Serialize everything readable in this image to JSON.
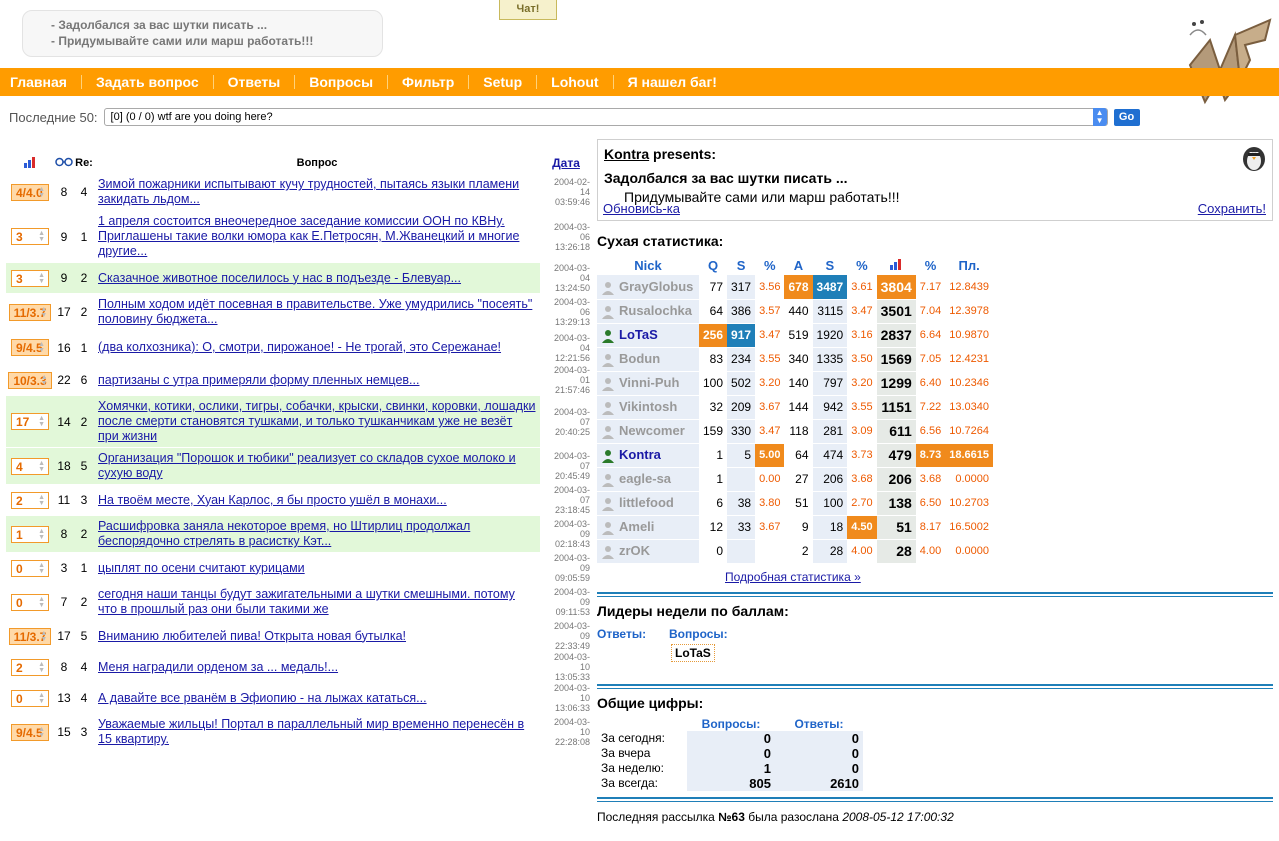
{
  "header": {
    "motd_line1": "- Задолбался за вас шутки писать ...",
    "motd_line2": "- Придумывайте сами или марш работать!!!",
    "chat_label": "Чат!"
  },
  "nav": [
    {
      "label": "Главная"
    },
    {
      "label": "Задать вопрос"
    },
    {
      "label": "Ответы"
    },
    {
      "label": "Вопросы"
    },
    {
      "label": "Фильтр"
    },
    {
      "label": "Setup"
    },
    {
      "label": "Lohout"
    },
    {
      "label": "Я нашел баг!"
    }
  ],
  "filter": {
    "label": "Последние 50:",
    "selected": "[0] (0 / 0) wtf are you doing here?",
    "go_label": "Go"
  },
  "questions_table": {
    "headers": {
      "re": "Re:",
      "question": "Вопрос",
      "date": "Дата"
    },
    "rows": [
      {
        "rate": "4/4.0",
        "views": "8",
        "re": "4",
        "text": "Зимой пожарники испытывают кучу трудностей, пытаясь языки пламени закидать льдом...",
        "date1": "2004-02-",
        "date2": "14",
        "time": "03:59:46",
        "highlight": false,
        "filled": true
      },
      {
        "rate": "3",
        "views": "9",
        "re": "1",
        "text": "1 апреля состоится внеочередное заседание комиссии ООН по КВНу. Приглашены такие волки юмора как Е.Петросян, М.Жванецкий и многие другие...",
        "date1": "2004-03-",
        "date2": "06",
        "time": "13:26:18",
        "highlight": false,
        "filled": false
      },
      {
        "rate": "3",
        "views": "9",
        "re": "2",
        "text": "Сказачное животное поселилось у нас в подъезде - Блевуар...",
        "date1": "2004-03-",
        "date2": "04",
        "time": "13:24:50",
        "highlight": true,
        "filled": false
      },
      {
        "rate": "11/3.7",
        "views": "17",
        "re": "2",
        "text": "Полным ходом идёт посевная в правительстве. Уже умудрились \"посеять\" половину бюджета...",
        "date1": "2004-03-",
        "date2": "06",
        "time": "13:29:13",
        "highlight": false,
        "filled": true
      },
      {
        "rate": "9/4.5",
        "views": "16",
        "re": "1",
        "text": "(два колхозника): О, смотри, пирожаное! - Не трогай, это Сережанае!",
        "date1": "2004-03-",
        "date2": "04",
        "time": "12:21:56",
        "highlight": false,
        "filled": true
      },
      {
        "rate": "10/3.3",
        "views": "22",
        "re": "6",
        "text": "партизаны с утра примеряли форму пленных немцев...",
        "date1": "2004-03-",
        "date2": "01",
        "time": "21:57:46",
        "highlight": false,
        "filled": true
      },
      {
        "rate": "17",
        "views": "14",
        "re": "2",
        "text": "Хомячки, котики, ослики, тигры, собачки, крыски, свинки, коровки, лошадки после смерти становятся тушками, и только тушканчикам уже не везёт при жизни",
        "date1": "2004-03-",
        "date2": "07",
        "time": "20:40:25",
        "highlight": true,
        "filled": false
      },
      {
        "rate": "4",
        "views": "18",
        "re": "5",
        "text": "Организация \"Порошок и тюбики\" реализует со складов сухое молоко и сухую воду",
        "date1": "2004-03-",
        "date2": "07",
        "time": "20:45:49",
        "highlight": true,
        "filled": false
      },
      {
        "rate": "2",
        "views": "11",
        "re": "3",
        "text": "На твоём месте, Хуан Карлос, я бы просто ушёл в монахи...",
        "date1": "2004-03-",
        "date2": "07",
        "time": "23:18:45",
        "highlight": false,
        "filled": false
      },
      {
        "rate": "1",
        "views": "8",
        "re": "2",
        "text": "Расшифровка заняла некоторое время, но Штирлиц продолжал беспорядочно стрелять в расистку Кэт...",
        "date1": "2004-03-",
        "date2": "09",
        "time": "02:18:43",
        "highlight": true,
        "filled": false
      },
      {
        "rate": "0",
        "views": "3",
        "re": "1",
        "text": "цыплят по осени считают курицами",
        "date1": "2004-03-",
        "date2": "09",
        "time": "09:05:59",
        "highlight": false,
        "filled": false
      },
      {
        "rate": "0",
        "views": "7",
        "re": "2",
        "text": "сегодня наши танцы будут зажигательными а шутки смешными. потому что в прошлый раз они были такими же",
        "date1": "2004-03-",
        "date2": "09",
        "time": "09:11:53",
        "highlight": false,
        "filled": false
      },
      {
        "rate": "11/3.7",
        "views": "17",
        "re": "5",
        "text": "Вниманию любителей пива! Открыта новая бутылка!",
        "date1": "2004-03-",
        "date2": "09",
        "time": "22:33:49",
        "highlight": false,
        "filled": true
      },
      {
        "rate": "2",
        "views": "8",
        "re": "4",
        "text": "Меня наградили орденом за ... медаль!...",
        "date1": "2004-03-",
        "date2": "10",
        "time": "13:05:33",
        "highlight": false,
        "filled": false
      },
      {
        "rate": "0",
        "views": "13",
        "re": "4",
        "text": "А давайте все рванём в Эфиопию - на лыжах кататься...",
        "date1": "2004-03-",
        "date2": "10",
        "time": "13:06:33",
        "highlight": false,
        "filled": false
      },
      {
        "rate": "9/4.5",
        "views": "15",
        "re": "3",
        "text": "Уважаемые жильцы! Портал в параллельный мир временно перенесён в 15 квартиру.",
        "date1": "2004-03-",
        "date2": "10",
        "time": "22:28:08",
        "highlight": false,
        "filled": true
      }
    ]
  },
  "presents": {
    "author": "Kontra",
    "suffix": " presents:",
    "line1": "Задолбался за вас шутки писать ...",
    "line2": "Придумывайте сами или марш работать!!!",
    "refresh": "Обновись-ка",
    "save": "Сохранить!"
  },
  "stats": {
    "title": "Сухая статистика:",
    "headers": [
      "Nick",
      "Q",
      "S",
      "%",
      "A",
      "S",
      "%",
      "",
      "%",
      "Пл."
    ],
    "rows": [
      {
        "nick": "GrayGlobus",
        "q": "77",
        "s": "317",
        "p": "3.56",
        "a": "678",
        "s2": "3487",
        "p2": "3.61",
        "score": "3804",
        "p3": "7.17",
        "pl": "12.8439",
        "active": false,
        "hot_a": true,
        "cold_s2": true,
        "hot_score": true
      },
      {
        "nick": "Rusalochka",
        "q": "64",
        "s": "386",
        "p": "3.57",
        "a": "440",
        "s2": "3115",
        "p2": "3.47",
        "score": "3501",
        "p3": "7.04",
        "pl": "12.3978",
        "active": false
      },
      {
        "nick": "LoTaS",
        "q": "256",
        "s": "917",
        "p": "3.47",
        "a": "519",
        "s2": "1920",
        "p2": "3.16",
        "score": "2837",
        "p3": "6.64",
        "pl": "10.9870",
        "active": true,
        "hot_q": true,
        "cold_s": true
      },
      {
        "nick": "Bodun",
        "q": "83",
        "s": "234",
        "p": "3.55",
        "a": "340",
        "s2": "1335",
        "p2": "3.50",
        "score": "1569",
        "p3": "7.05",
        "pl": "12.4231",
        "active": false
      },
      {
        "nick": "Vinni-Puh",
        "q": "100",
        "s": "502",
        "p": "3.20",
        "a": "140",
        "s2": "797",
        "p2": "3.20",
        "score": "1299",
        "p3": "6.40",
        "pl": "10.2346",
        "active": false
      },
      {
        "nick": "Vikintosh",
        "q": "32",
        "s": "209",
        "p": "3.67",
        "a": "144",
        "s2": "942",
        "p2": "3.55",
        "score": "1151",
        "p3": "7.22",
        "pl": "13.0340",
        "active": false
      },
      {
        "nick": "Newcomer",
        "q": "159",
        "s": "330",
        "p": "3.47",
        "a": "118",
        "s2": "281",
        "p2": "3.09",
        "score": "611",
        "p3": "6.56",
        "pl": "10.7264",
        "active": false
      },
      {
        "nick": "Kontra",
        "q": "1",
        "s": "5",
        "p": "5.00",
        "a": "64",
        "s2": "474",
        "p2": "3.73",
        "score": "479",
        "p3": "8.73",
        "pl": "18.6615",
        "active": true,
        "hot_p": true,
        "hot_p3": true,
        "hot_pl": true
      },
      {
        "nick": "eagle-sa",
        "q": "1",
        "s": "",
        "p": "0.00",
        "a": "27",
        "s2": "206",
        "p2": "3.68",
        "score": "206",
        "p3": "3.68",
        "pl": "0.0000",
        "active": false
      },
      {
        "nick": "littlefood",
        "q": "6",
        "s": "38",
        "p": "3.80",
        "a": "51",
        "s2": "100",
        "p2": "2.70",
        "score": "138",
        "p3": "6.50",
        "pl": "10.2703",
        "active": false
      },
      {
        "nick": "Ameli",
        "q": "12",
        "s": "33",
        "p": "3.67",
        "a": "9",
        "s2": "18",
        "p2": "4.50",
        "score": "51",
        "p3": "8.17",
        "pl": "16.5002",
        "active": false,
        "hot_p2": true
      },
      {
        "nick": "zrOK",
        "q": "0",
        "s": "",
        "p": "",
        "a": "2",
        "s2": "28",
        "p2": "4.00",
        "score": "28",
        "p3": "4.00",
        "pl": "0.0000",
        "active": false
      }
    ],
    "detail_link": "Подробная статистика »"
  },
  "leaders": {
    "title": "Лидеры недели по баллам:",
    "answers_label": "Ответы:",
    "questions_label": "Вопросы:",
    "questions_leader": "LoTaS"
  },
  "totals": {
    "title": "Общие цифры:",
    "col_q": "Вопросы:",
    "col_a": "Ответы:",
    "rows": [
      {
        "label": "За сегодня:",
        "q": "0",
        "a": "0"
      },
      {
        "label": "За вчера",
        "q": "0",
        "a": "0"
      },
      {
        "label": "За неделю:",
        "q": "1",
        "a": "0"
      },
      {
        "label": "За всегда:",
        "q": "805",
        "a": "2610"
      }
    ]
  },
  "mailing": {
    "prefix": "Последняя рассылка ",
    "number": "№63",
    "middle": " была разослана ",
    "date": "2008-05-12 17:00:32"
  },
  "colors": {
    "orange": "#ff9c00",
    "blue": "#1f7fb8",
    "green_row": "#e2f8d9"
  }
}
